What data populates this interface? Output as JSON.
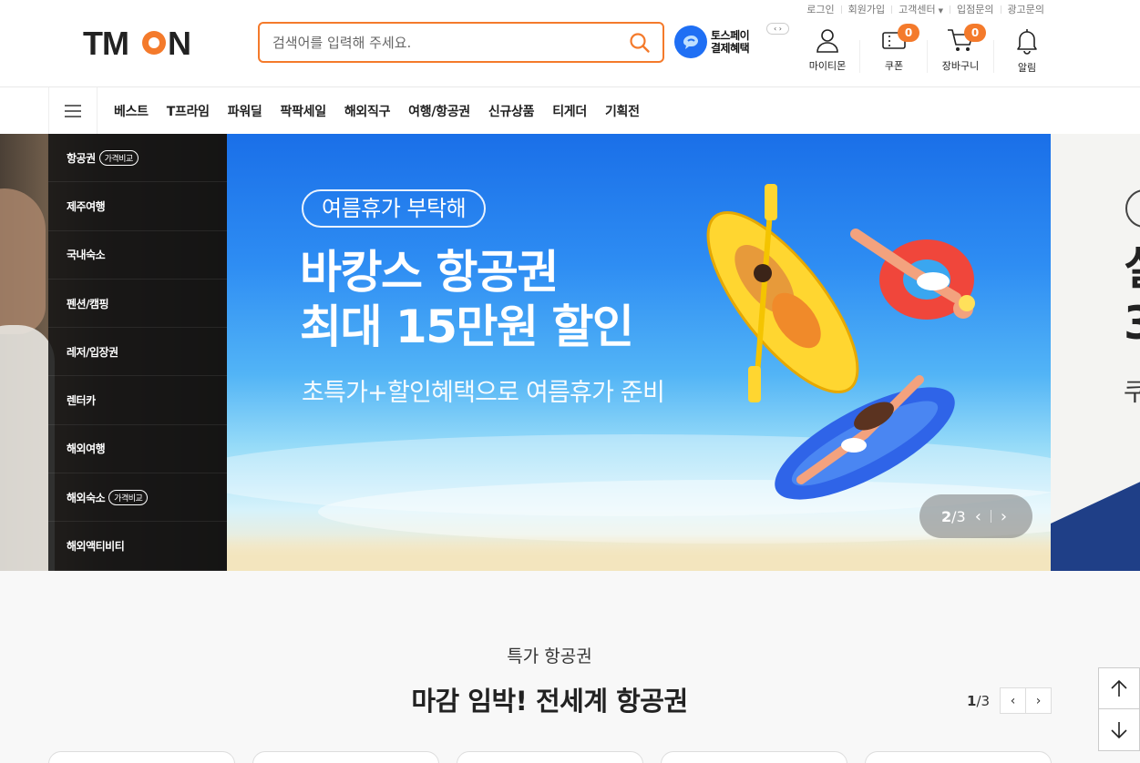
{
  "util_links": [
    "로그인",
    "회원가입",
    "고객센터",
    "입점문의",
    "광고문의"
  ],
  "brand": {
    "logo_text": "TMON",
    "accent_color": "#f47a2b",
    "dark_color": "#222222"
  },
  "search": {
    "placeholder": "검색어를 입력해 주세요.",
    "value": ""
  },
  "toss": {
    "line1": "토스페이",
    "line2": "결제혜택",
    "color": "#1f6ff4"
  },
  "header_icons": {
    "mytmon": {
      "label": "마이티몬",
      "icon": "user-icon"
    },
    "coupon": {
      "label": "쿠폰",
      "badge": "0",
      "icon": "coupon-icon"
    },
    "cart": {
      "label": "장바구니",
      "badge": "0",
      "icon": "cart-icon"
    },
    "alarm": {
      "label": "알림",
      "icon": "bell-icon"
    }
  },
  "nav": [
    "베스트",
    "T프라임",
    "파워딜",
    "팍팍세일",
    "해외직구",
    "여행/항공권",
    "신규상품",
    "티게더",
    "기획전"
  ],
  "categories": [
    {
      "label": "항공권",
      "tag": "가격비교"
    },
    {
      "label": "제주여행",
      "tag": ""
    },
    {
      "label": "국내숙소",
      "tag": ""
    },
    {
      "label": "펜션/캠핑",
      "tag": ""
    },
    {
      "label": "레저/입장권",
      "tag": ""
    },
    {
      "label": "렌터카",
      "tag": ""
    },
    {
      "label": "해외여행",
      "tag": ""
    },
    {
      "label": "해외숙소",
      "tag": "가격비교"
    },
    {
      "label": "해외액티비티",
      "tag": ""
    }
  ],
  "banner": {
    "pill": "여름휴가 부탁해",
    "line1": "바캉스 항공권",
    "line2": "최대 15만원 할인",
    "sub": "초특가+할인혜택으로 여름휴가 준비",
    "current": "2",
    "total": "/3"
  },
  "next_banner": {
    "big_line1": "실",
    "big_line2": "3",
    "small": "쿠"
  },
  "section": {
    "subtitle": "특가 항공권",
    "title": "마감 임박! 전세계 항공권",
    "page_current": "1",
    "page_total": "/3"
  }
}
